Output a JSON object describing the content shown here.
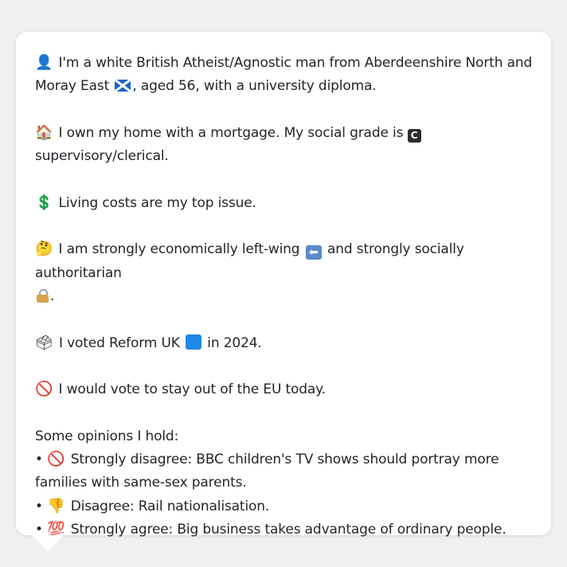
{
  "bubble": {
    "paragraphs": {
      "identity": {
        "icon": "bust-in-silhouette-icon",
        "line1": "I'm a white British Atheist/Agnostic man from Aberdeenshire North and",
        "line2a": "Moray East",
        "line2b": ", aged 56, with a university diploma."
      },
      "home": {
        "icon": "house-icon",
        "line1": "I own my home with a mortgage. My social grade is",
        "grade_letter": "C",
        "line2": "supervisory/clerical."
      },
      "issue": {
        "icon": "dollar-sign-icon",
        "text": "Living costs are my top issue."
      },
      "politics": {
        "icon": "thinking-face-icon",
        "line1a": "I am strongly economically left-wing",
        "line1b": "and strongly socially authoritarian",
        "line2": "."
      },
      "vote": {
        "icon": "ballot-box-icon",
        "text_a": "I voted Reform UK",
        "text_b": "in 2024."
      },
      "eu": {
        "icon": "prohibited-icon",
        "text": "I would vote to stay out of the EU today."
      }
    },
    "opinions": {
      "heading": "Some opinions I hold:",
      "items": [
        {
          "bullet": "•",
          "icon": "prohibited-icon",
          "line1": "Strongly disagree: BBC children's TV shows should portray more",
          "line2": "families with same-sex parents."
        },
        {
          "bullet": "•",
          "icon": "thumbs-down-icon",
          "line1": "Disagree: Rail nationalisation."
        },
        {
          "bullet": "•",
          "icon": "hundred-points-icon",
          "line1": "Strongly agree: Big business takes advantage of ordinary people."
        }
      ]
    }
  },
  "colors": {
    "background": "#eef0f2",
    "bubble": "#ffffff",
    "text": "#1f2429"
  }
}
